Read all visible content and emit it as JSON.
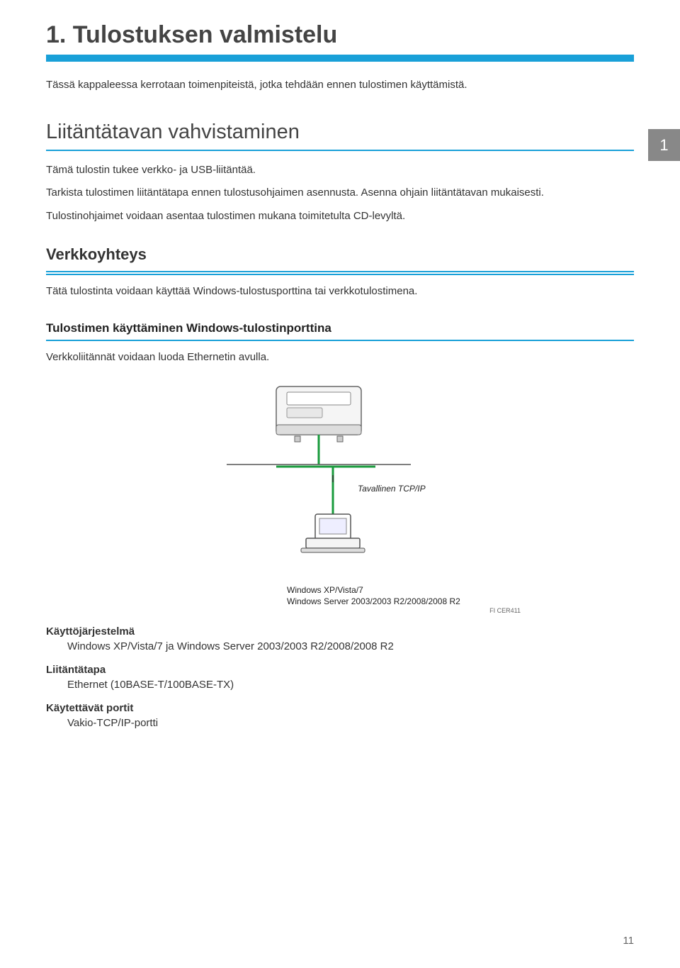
{
  "chapter": {
    "title": "1. Tulostuksen valmistelu",
    "intro": "Tässä kappaleessa kerrotaan toimenpiteistä, jotka tehdään ennen tulostimen käyttämistä."
  },
  "side_tab": "1",
  "section1": {
    "heading": "Liitäntätavan vahvistaminen",
    "p1": "Tämä tulostin tukee verkko- ja USB-liitäntää.",
    "p2": "Tarkista tulostimen liitäntätapa ennen tulostusohjaimen asennusta. Asenna ohjain liitäntätavan mukaisesti.",
    "p3": "Tulostinohjaimet voidaan asentaa tulostimen mukana toimitetulta CD-levyltä."
  },
  "subsection": {
    "heading": "Verkkoyhteys",
    "p1": "Tätä tulostinta voidaan käyttää Windows-tulostusporttina tai verkkotulostimena."
  },
  "subsub": {
    "heading": "Tulostimen käyttäminen Windows-tulostinporttina",
    "p1": "Verkkoliitännät voidaan luoda Ethernetin avulla."
  },
  "diagram": {
    "label_tcpip": "Tavallinen TCP/IP",
    "os1": "Windows XP/Vista/7",
    "os2": "Windows Server 2003/2003 R2/2008/2008 R2",
    "img_id": "FI CER411"
  },
  "spec": {
    "os_label": "Käyttöjärjestelmä",
    "os_value": "Windows XP/Vista/7 ja Windows Server 2003/2003 R2/2008/2008 R2",
    "conn_label": "Liitäntätapa",
    "conn_value": "Ethernet (10BASE-T/100BASE-TX)",
    "port_label": "Käytettävät portit",
    "port_value": "Vakio-TCP/IP-portti"
  },
  "page_number": "11"
}
